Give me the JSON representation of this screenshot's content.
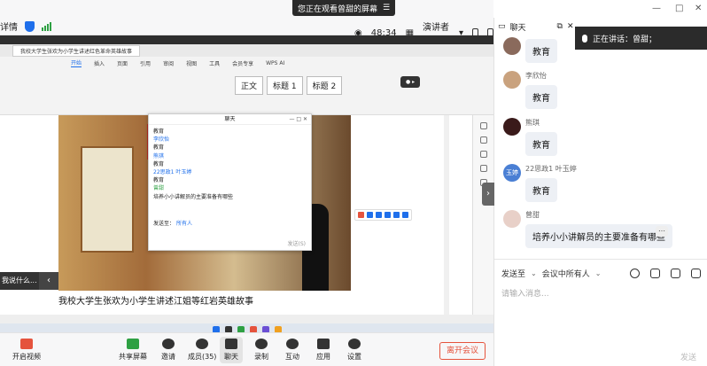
{
  "top_bar": {
    "title": "详情",
    "share_banner": "您正在观看曾甜的屏幕",
    "timer": "48:34",
    "view_mode": "演讲者视图"
  },
  "chat_panel": {
    "title": "聊天",
    "speaking": "正在讲话：曾甜；",
    "messages": [
      {
        "name": "",
        "text": "教育",
        "avatar_color": "#8a6a5c"
      },
      {
        "name": "李欣怡",
        "text": "教育",
        "avatar_color": "#c9a27e"
      },
      {
        "name": "熊琪",
        "text": "教育",
        "avatar_color": "#3a1a1a"
      },
      {
        "name": "22思政1 叶玉婷",
        "text": "教育",
        "avatar_color": "#4a7fd4",
        "avatar_text": "玉婷"
      },
      {
        "name": "曾甜",
        "text": "培养小小讲解员的主要准备有哪些",
        "avatar_color": "#e8d0c8"
      }
    ],
    "send_to_label": "发送至",
    "send_to_value": "会议中所有人",
    "input_placeholder": "请输入消息...",
    "send_label": "发送"
  },
  "shared_screen": {
    "doc_tab": "我校大学生张欢为小学生讲述红色革命英雄故事",
    "ribbon_tabs": [
      "开始",
      "插入",
      "页面",
      "引用",
      "审阅",
      "视图",
      "工具",
      "会员专享",
      "WPS AI"
    ],
    "styles": [
      "正文",
      "标题 1",
      "标题 2"
    ],
    "caption": "我校大学生张欢为小学生讲述江姐等红岩英雄故事",
    "inner_chat": {
      "title": "聊天",
      "lines": [
        {
          "text": "教育",
          "color": "normal"
        },
        {
          "text": "李欣怡",
          "color": "blue"
        },
        {
          "text": "教育",
          "color": "normal"
        },
        {
          "text": "熊琪",
          "color": "blue"
        },
        {
          "text": "教育",
          "color": "normal"
        },
        {
          "text": "22思政1 叶玉婷",
          "color": "blue"
        },
        {
          "text": "教育",
          "color": "normal"
        },
        {
          "text": "曾甜",
          "color": "green"
        },
        {
          "text": "培养小小讲解员的主要准备有哪些",
          "color": "normal"
        }
      ],
      "send_to": "发送至：",
      "send_to_value": "所有人",
      "send_btn": "发送(S)"
    },
    "subtitle": "我说什么..."
  },
  "controls": {
    "buttons": [
      {
        "label": "开启视频"
      },
      {
        "label": "共享屏幕"
      },
      {
        "label": "邀请"
      },
      {
        "label": "成员(35)"
      },
      {
        "label": "聊天"
      },
      {
        "label": "录制"
      },
      {
        "label": "互动"
      },
      {
        "label": "应用"
      },
      {
        "label": "设置"
      }
    ],
    "leave": "离开会议"
  }
}
